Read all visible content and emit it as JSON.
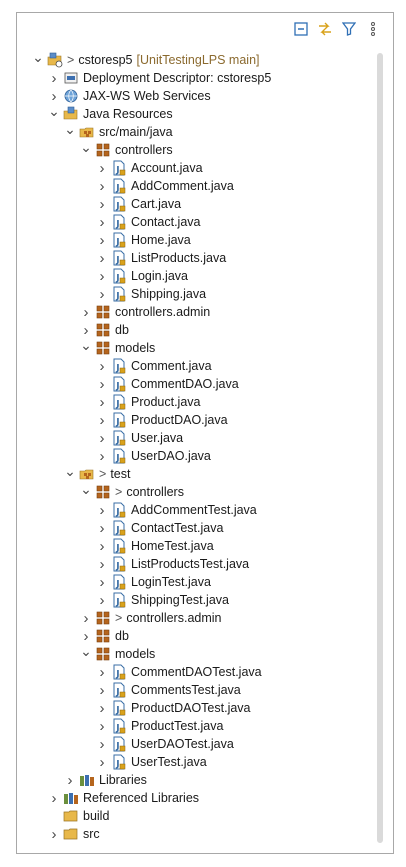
{
  "toolbar": {
    "buttons": [
      {
        "name": "collapse-all-button",
        "icon": "collapse-all-icon"
      },
      {
        "name": "link-with-editor-button",
        "icon": "link-editor-icon"
      },
      {
        "name": "filter-button",
        "icon": "filter-icon"
      },
      {
        "name": "view-menu-button",
        "icon": "kebab-menu-icon"
      }
    ]
  },
  "tree": [
    {
      "label": "cstoresp5",
      "deco": "[UnitTestingLPS main]",
      "git": true,
      "icon": "project",
      "level": 0,
      "state": "expanded"
    },
    {
      "label": "Deployment Descriptor: cstoresp5",
      "icon": "deploy",
      "level": 1,
      "state": "collapsed"
    },
    {
      "label": "JAX-WS Web Services",
      "icon": "ws",
      "level": 1,
      "state": "collapsed"
    },
    {
      "label": "Java Resources",
      "icon": "javares",
      "level": 1,
      "state": "expanded"
    },
    {
      "label": "src/main/java",
      "icon": "srcfolder",
      "level": 2,
      "state": "expanded"
    },
    {
      "label": "controllers",
      "icon": "package",
      "level": 3,
      "state": "expanded"
    },
    {
      "label": "Account.java",
      "icon": "java",
      "level": 4,
      "state": "collapsed"
    },
    {
      "label": "AddComment.java",
      "icon": "java",
      "level": 4,
      "state": "collapsed"
    },
    {
      "label": "Cart.java",
      "icon": "java",
      "level": 4,
      "state": "collapsed"
    },
    {
      "label": "Contact.java",
      "icon": "java",
      "level": 4,
      "state": "collapsed"
    },
    {
      "label": "Home.java",
      "icon": "java",
      "level": 4,
      "state": "collapsed"
    },
    {
      "label": "ListProducts.java",
      "icon": "java",
      "level": 4,
      "state": "collapsed"
    },
    {
      "label": "Login.java",
      "icon": "java",
      "level": 4,
      "state": "collapsed"
    },
    {
      "label": "Shipping.java",
      "icon": "java",
      "level": 4,
      "state": "collapsed"
    },
    {
      "label": "controllers.admin",
      "icon": "package",
      "level": 3,
      "state": "collapsed"
    },
    {
      "label": "db",
      "icon": "package",
      "level": 3,
      "state": "collapsed"
    },
    {
      "label": "models",
      "icon": "package",
      "level": 3,
      "state": "expanded"
    },
    {
      "label": "Comment.java",
      "icon": "java",
      "level": 4,
      "state": "collapsed"
    },
    {
      "label": "CommentDAO.java",
      "icon": "java",
      "level": 4,
      "state": "collapsed"
    },
    {
      "label": "Product.java",
      "icon": "java",
      "level": 4,
      "state": "collapsed"
    },
    {
      "label": "ProductDAO.java",
      "icon": "java",
      "level": 4,
      "state": "collapsed"
    },
    {
      "label": "User.java",
      "icon": "java",
      "level": 4,
      "state": "collapsed"
    },
    {
      "label": "UserDAO.java",
      "icon": "java",
      "level": 4,
      "state": "collapsed"
    },
    {
      "label": "test",
      "git": true,
      "icon": "srcfolder",
      "level": 2,
      "state": "expanded"
    },
    {
      "label": "controllers",
      "git": true,
      "icon": "package",
      "level": 3,
      "state": "expanded"
    },
    {
      "label": "AddCommentTest.java",
      "icon": "java",
      "level": 4,
      "state": "collapsed"
    },
    {
      "label": "ContactTest.java",
      "icon": "java",
      "level": 4,
      "state": "collapsed"
    },
    {
      "label": "HomeTest.java",
      "icon": "java",
      "level": 4,
      "state": "collapsed"
    },
    {
      "label": "ListProductsTest.java",
      "icon": "java",
      "level": 4,
      "state": "collapsed"
    },
    {
      "label": "LoginTest.java",
      "icon": "java",
      "level": 4,
      "state": "collapsed"
    },
    {
      "label": "ShippingTest.java",
      "icon": "java",
      "level": 4,
      "state": "collapsed"
    },
    {
      "label": "controllers.admin",
      "git": true,
      "icon": "package",
      "level": 3,
      "state": "collapsed"
    },
    {
      "label": "db",
      "icon": "package",
      "level": 3,
      "state": "collapsed"
    },
    {
      "label": "models",
      "icon": "package",
      "level": 3,
      "state": "expanded"
    },
    {
      "label": "CommentDAOTest.java",
      "icon": "java",
      "level": 4,
      "state": "collapsed"
    },
    {
      "label": "CommentsTest.java",
      "icon": "java",
      "level": 4,
      "state": "collapsed"
    },
    {
      "label": "ProductDAOTest.java",
      "icon": "java",
      "level": 4,
      "state": "collapsed"
    },
    {
      "label": "ProductTest.java",
      "icon": "java",
      "level": 4,
      "state": "collapsed"
    },
    {
      "label": "UserDAOTest.java",
      "icon": "java",
      "level": 4,
      "state": "collapsed"
    },
    {
      "label": "UserTest.java",
      "icon": "java",
      "level": 4,
      "state": "collapsed"
    },
    {
      "label": "Libraries",
      "icon": "libraries",
      "level": 2,
      "state": "collapsed"
    },
    {
      "label": "Referenced Libraries",
      "icon": "libraries",
      "level": 1,
      "state": "collapsed"
    },
    {
      "label": "build",
      "icon": "folder",
      "level": 1,
      "state": "none"
    },
    {
      "label": "src",
      "icon": "folder",
      "level": 1,
      "state": "collapsed"
    }
  ],
  "colors": {
    "package": "#b5651d",
    "java": "#3a6ea5",
    "folder": "#e8b84a",
    "decoration": "#8b6a2f"
  }
}
